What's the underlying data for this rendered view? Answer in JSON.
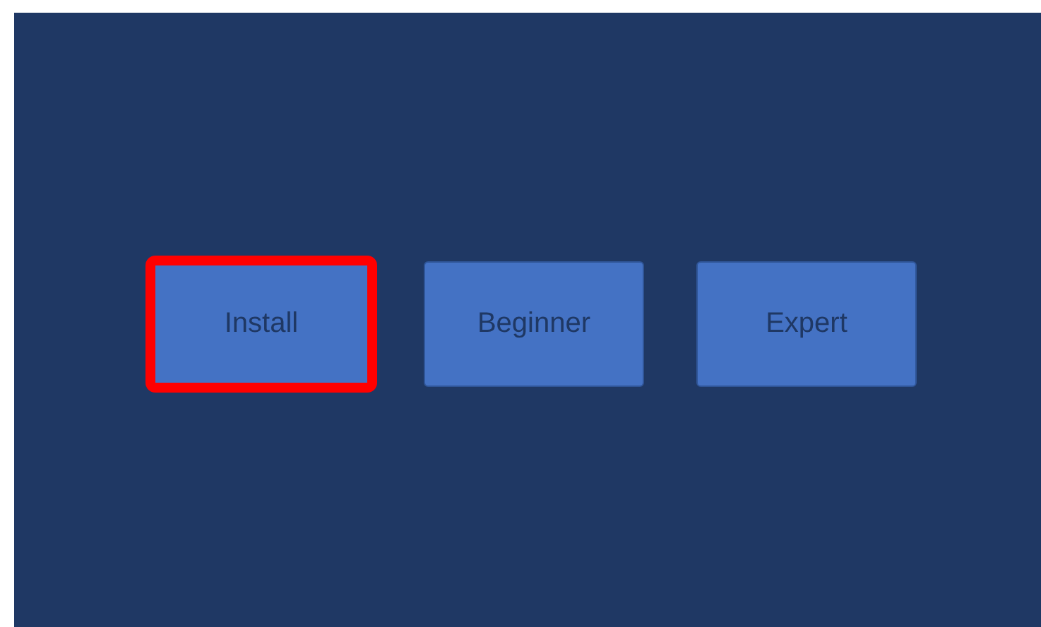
{
  "buttons": [
    {
      "label": "Install",
      "selected": true
    },
    {
      "label": "Beginner",
      "selected": false
    },
    {
      "label": "Expert",
      "selected": false
    }
  ]
}
